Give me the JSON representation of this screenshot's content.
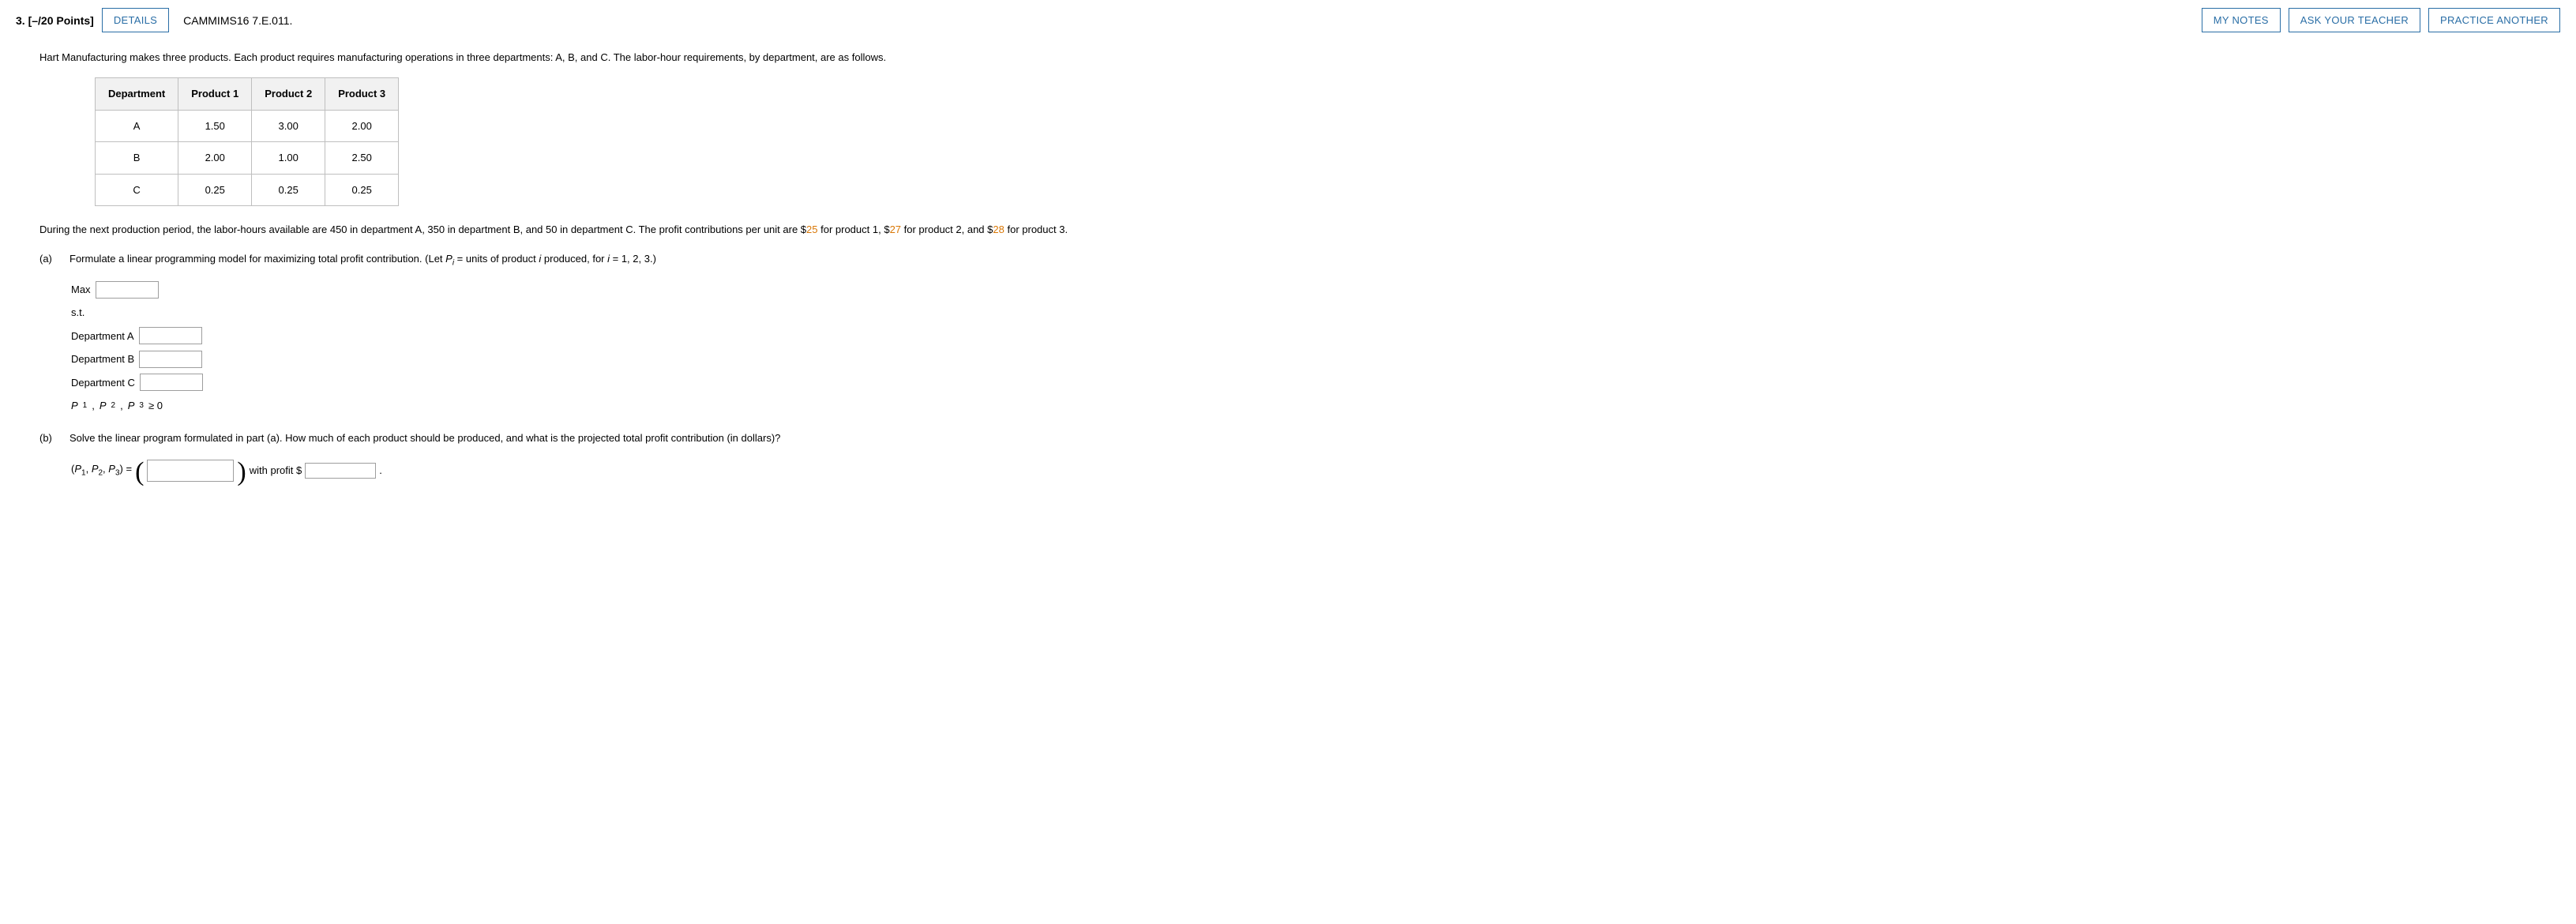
{
  "header": {
    "number": "3.",
    "points": "[–/20 Points]",
    "details_btn": "DETAILS",
    "refcode": "CAMMIMS16 7.E.011.",
    "mynotes_btn": "MY NOTES",
    "askteacher_btn": "ASK YOUR TEACHER",
    "practice_btn": "PRACTICE ANOTHER"
  },
  "intro": "Hart Manufacturing makes three products. Each product requires manufacturing operations in three departments: A, B, and C. The labor-hour requirements, by department, are as follows.",
  "table": {
    "headers": [
      "Department",
      "Product 1",
      "Product 2",
      "Product 3"
    ],
    "rows": [
      [
        "A",
        "1.50",
        "3.00",
        "2.00"
      ],
      [
        "B",
        "2.00",
        "1.00",
        "2.50"
      ],
      [
        "C",
        "0.25",
        "0.25",
        "0.25"
      ]
    ]
  },
  "para2_pre": "During the next production period, the labor-hours available are 450 in department A, 350 in department B, and 50 in department C. The profit contributions per unit are $",
  "profit1": "25",
  "para2_mid1": " for product 1, $",
  "profit2": "27",
  "para2_mid2": " for product 2, and $",
  "profit3": "28",
  "para2_post": " for product 3.",
  "part_a": {
    "label": "(a)",
    "text_pre": "Formulate a linear programming model for maximizing total profit contribution. (Let ",
    "var": "P",
    "sub": "i",
    "text_mid": " = units of product ",
    "ivar": "i",
    "text_post": " produced, for ",
    "ivar2": "i",
    "eq": " = 1, 2, 3.)",
    "max": "Max",
    "st": "s.t.",
    "depA": "Department A",
    "depB": "Department B",
    "depC": "Department C",
    "nonneg_p": "P",
    "nonneg_s1": "1",
    "nonneg_c": ", ",
    "nonneg_s2": "2",
    "nonneg_s3": "3",
    "nonneg_tail": " ≥ 0"
  },
  "part_b": {
    "label": "(b)",
    "text": "Solve the linear program formulated in part (a). How much of each product should be produced, and what is the projected total profit contribution (in dollars)?",
    "paren_open": "(",
    "tuple_p": "P",
    "s1": "1",
    "c": ", ",
    "s2": "2",
    "s3": "3",
    "paren_close": ")",
    "eq": " = ",
    "with_profit": " with profit $ ",
    "period": "."
  }
}
